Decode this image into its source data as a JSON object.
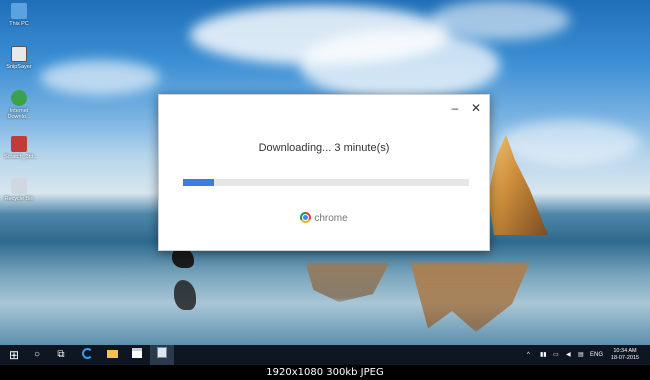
{
  "desktop": {
    "icons": [
      {
        "label": "This PC",
        "icon": "computer-icon",
        "color": "#5aa3e0"
      },
      {
        "label": "SnipSayer",
        "icon": "app-icon",
        "color": "#e8e8e8"
      },
      {
        "label": "Internet Downlo...",
        "icon": "globe-icon",
        "color": "#3aa34a"
      },
      {
        "label": "Scratch_3ttt...",
        "icon": "window-icon",
        "color": "#c23b3b"
      },
      {
        "label": "Recycle Bin",
        "icon": "recycle-bin-icon",
        "color": "#cfd8e0"
      }
    ]
  },
  "dialog": {
    "minimize": "–",
    "close": "✕",
    "status_text": "Downloading... 3 minute(s)",
    "progress": 0.11,
    "brand": "chrome",
    "accent": "#3b7de0"
  },
  "taskbar": {
    "start": "⊞",
    "search": "○",
    "task_view": "⧉",
    "apps": [
      "edge-icon",
      "file-explorer-icon",
      "store-icon",
      "installer-icon"
    ],
    "tray_chevron": "^",
    "language": "ENG",
    "time": "10:34 AM",
    "date": "18-07-2015"
  },
  "footer": {
    "text": "1920x1080  300kb  JPEG"
  }
}
